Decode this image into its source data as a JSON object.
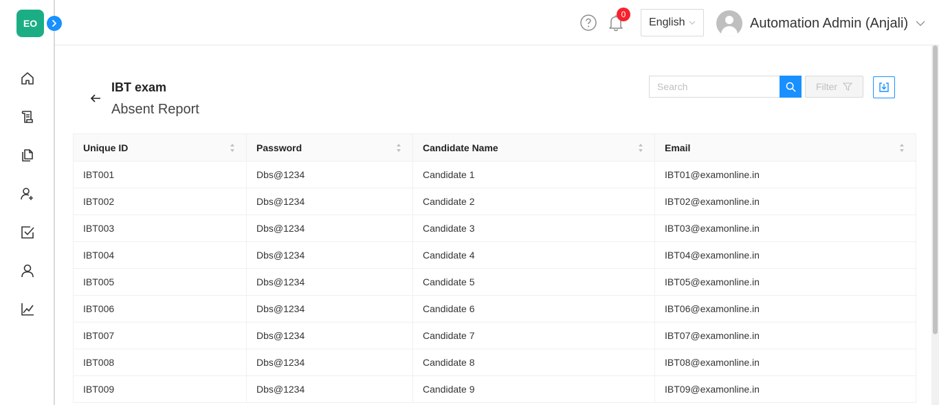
{
  "app": {
    "logo_text": "EO"
  },
  "header": {
    "notification_count": "0",
    "language": "English",
    "user_name": "Automation Admin (Anjali)"
  },
  "page": {
    "title": "IBT exam",
    "subtitle": "Absent Report"
  },
  "toolbar": {
    "search_placeholder": "Search",
    "filter_label": "Filter"
  },
  "colors": {
    "brand": "#1bae85",
    "primary": "#1890ff",
    "badge": "#f5222d"
  },
  "sidebar": {
    "icons": [
      "home-icon",
      "scroll-icon",
      "documents-icon",
      "user-add-icon",
      "checkbox-icon",
      "user-icon",
      "line-chart-icon"
    ]
  },
  "table": {
    "columns": [
      "Unique ID",
      "Password",
      "Candidate Name",
      "Email"
    ],
    "rows": [
      [
        "IBT001",
        "Dbs@1234",
        "Candidate 1",
        "IBT01@examonline.in"
      ],
      [
        "IBT002",
        "Dbs@1234",
        "Candidate 2",
        "IBT02@examonline.in"
      ],
      [
        "IBT003",
        "Dbs@1234",
        "Candidate 3",
        "IBT03@examonline.in"
      ],
      [
        "IBT004",
        "Dbs@1234",
        "Candidate 4",
        "IBT04@examonline.in"
      ],
      [
        "IBT005",
        "Dbs@1234",
        "Candidate 5",
        "IBT05@examonline.in"
      ],
      [
        "IBT006",
        "Dbs@1234",
        "Candidate 6",
        "IBT06@examonline.in"
      ],
      [
        "IBT007",
        "Dbs@1234",
        "Candidate 7",
        "IBT07@examonline.in"
      ],
      [
        "IBT008",
        "Dbs@1234",
        "Candidate 8",
        "IBT08@examonline.in"
      ],
      [
        "IBT009",
        "Dbs@1234",
        "Candidate 9",
        "IBT09@examonline.in"
      ]
    ]
  }
}
